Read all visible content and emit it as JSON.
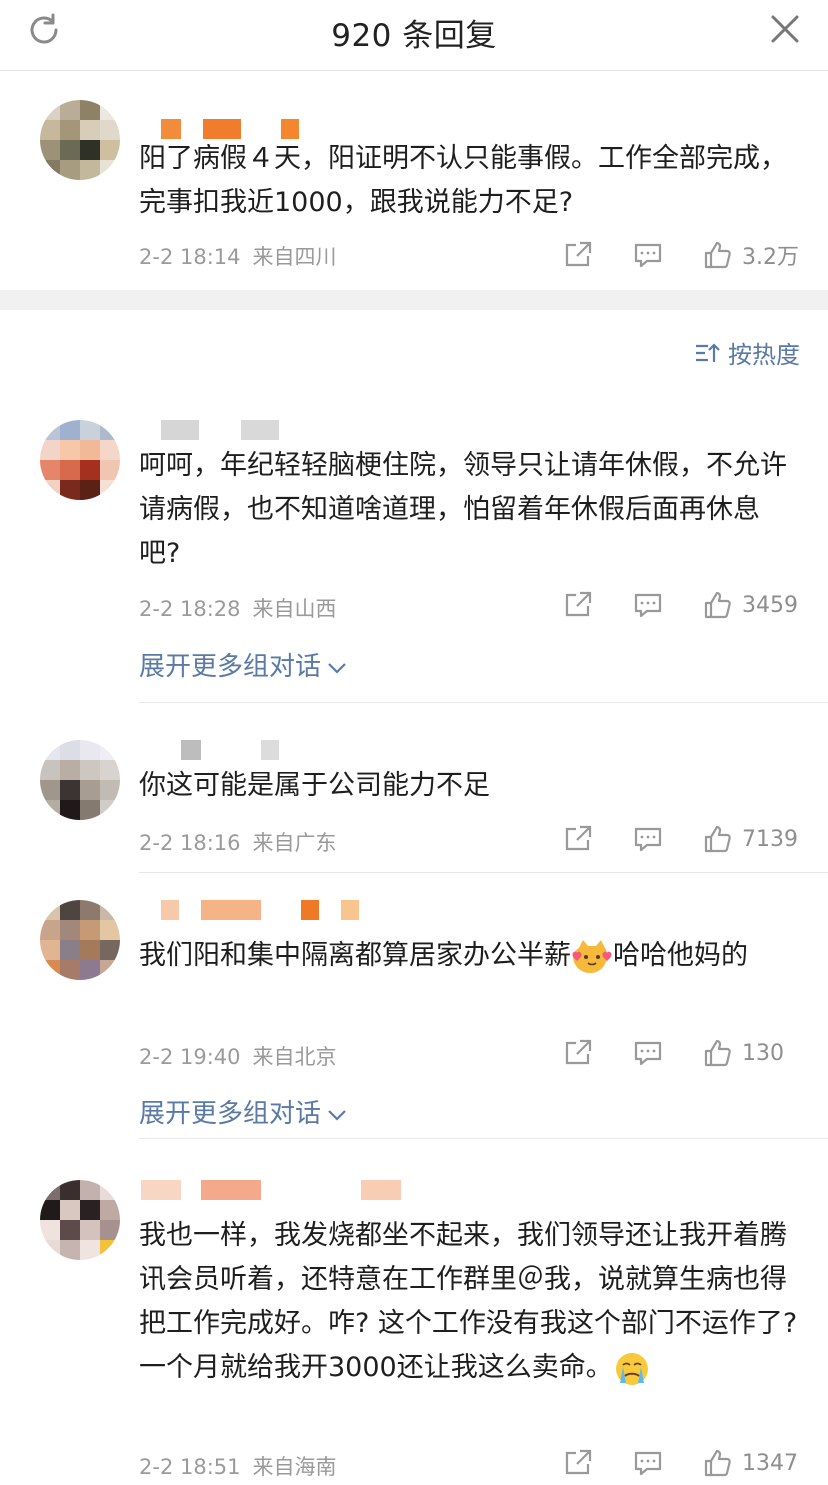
{
  "header": {
    "title": "920 条回复",
    "refresh_icon": "refresh-icon",
    "close_icon": "close-icon"
  },
  "sort": {
    "label": "按热度",
    "icon": "sort-icon"
  },
  "expand_label": "展开更多组对话",
  "colors": {
    "link": "#5a7aa6",
    "meta": "#9a9a9a",
    "divider": "#e8e8e8"
  },
  "comments": [
    {
      "text": "阳了病假４天，阳证明不认只能事假。工作全部完成，完事扣我近1000，跟我说能力不足?",
      "time": "2-2 18:14",
      "location": "来自四川",
      "likes": "3.2万"
    },
    {
      "text": "呵呵，年纪轻轻脑梗住院，领导只让请年休假，不允许请病假，也不知道啥道理，怕留着年休假后面再休息吧?",
      "time": "2-2 18:28",
      "location": "来自山西",
      "likes": "3459"
    },
    {
      "text": "你这可能是属于公司能力不足",
      "time": "2-2 18:16",
      "location": "来自广东",
      "likes": "7139"
    },
    {
      "text_before": "我们阳和集中隔离都算居家办公半薪",
      "text_after": "哈哈他妈的",
      "emoji": "cat-heart-emoji",
      "time": "2-2 19:40",
      "location": "来自北京",
      "likes": "130"
    },
    {
      "text": "我也一样，我发烧都坐不起来，我们领导还让我开着腾讯会员听着，还特意在工作群里＠我，说就算生病也得把工作完成好。咋? 这个工作没有我这个部门不运作了? 一个月就给我开3000还让我这么卖命。",
      "emoji": "crying-face-emoji",
      "time": "2-2 18:51",
      "location": "来自海南",
      "likes": "1347"
    }
  ]
}
